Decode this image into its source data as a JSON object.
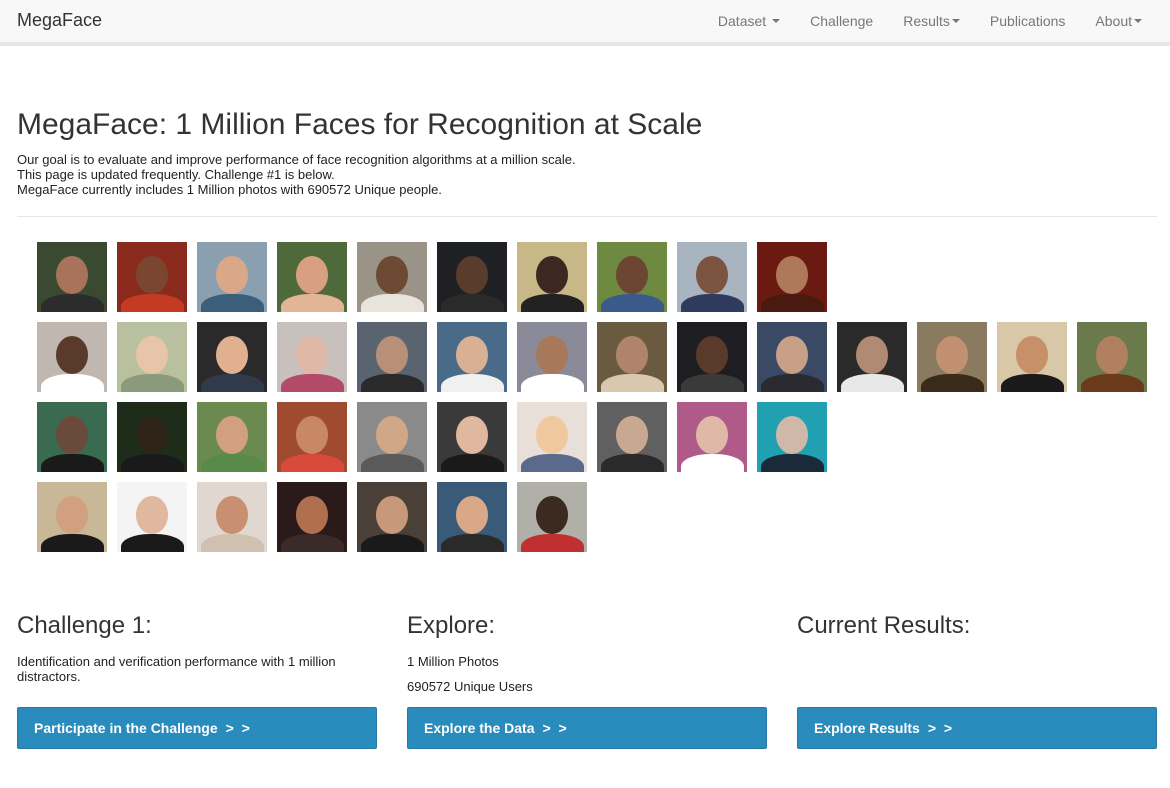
{
  "navbar": {
    "brand": "MegaFace",
    "items": [
      {
        "label": "Dataset",
        "caret": true
      },
      {
        "label": "Challenge",
        "caret": false
      },
      {
        "label": "Results",
        "caret": true
      },
      {
        "label": "Publications",
        "caret": false
      },
      {
        "label": "About",
        "caret": true
      }
    ]
  },
  "header": {
    "title": "MegaFace: 1 Million Faces for Recognition at Scale",
    "lines": [
      "Our goal is to evaluate and improve performance of face recognition algorithms at a million scale.",
      "This page is updated frequently. Challenge #1 is below.",
      "MegaFace currently includes 1 Million photos with 690572 Unique people."
    ]
  },
  "faces": {
    "rows": [
      [
        {
          "bg": "#3a4a30",
          "skin": "#a8735a",
          "shirt": "#2c2c2c"
        },
        {
          "bg": "#8a2a1c",
          "skin": "#7a4630",
          "shirt": "#c43a22"
        },
        {
          "bg": "#8aa0b0",
          "skin": "#d9a888",
          "shirt": "#3b5e7a"
        },
        {
          "bg": "#4e6a3a",
          "skin": "#d8a080",
          "shirt": "#e2b597"
        },
        {
          "bg": "#9a9488",
          "skin": "#6d4a34",
          "shirt": "#e8e4dc"
        },
        {
          "bg": "#1e2024",
          "skin": "#5a3c2c",
          "shirt": "#2a2a2a"
        },
        {
          "bg": "#c8b888",
          "skin": "#3c2820",
          "shirt": "#222222"
        },
        {
          "bg": "#6e8a40",
          "skin": "#6c4632",
          "shirt": "#3a5a8a"
        },
        {
          "bg": "#a8b4c0",
          "skin": "#7a5440",
          "shirt": "#2e3a5e"
        },
        {
          "bg": "#6a1a10",
          "skin": "#b0785a",
          "shirt": "#4a1a10"
        }
      ],
      [
        {
          "bg": "#c0b8b0",
          "skin": "#5a3a2a",
          "shirt": "#ffffff"
        },
        {
          "bg": "#b8c0a0",
          "skin": "#e8c4a8",
          "shirt": "#8a9a7a"
        },
        {
          "bg": "#2a2a2a",
          "skin": "#e0b090",
          "shirt": "#303a4a"
        },
        {
          "bg": "#c8c0bc",
          "skin": "#e0b8a8",
          "shirt": "#b44a6a"
        },
        {
          "bg": "#5a6470",
          "skin": "#b89078",
          "shirt": "#2a2a2a"
        },
        {
          "bg": "#4a6a8a",
          "skin": "#d8b094",
          "shirt": "#f0f0f0"
        },
        {
          "bg": "#8a8a98",
          "skin": "#a8785a",
          "shirt": "#ffffff"
        },
        {
          "bg": "#6a5a40",
          "skin": "#b0846a",
          "shirt": "#d8c8b0"
        },
        {
          "bg": "#1e1e22",
          "skin": "#5a3a2a",
          "shirt": "#3a3a3a"
        },
        {
          "bg": "#3a4a64",
          "skin": "#c8a088",
          "shirt": "#2a2a30"
        },
        {
          "bg": "#2a2a2a",
          "skin": "#b08a72",
          "shirt": "#e8e8e8"
        },
        {
          "bg": "#8a7a60",
          "skin": "#c09070",
          "shirt": "#3a2a1a"
        },
        {
          "bg": "#d8c8a8",
          "skin": "#c89068",
          "shirt": "#1a1a1a"
        },
        {
          "bg": "#6a7a4a",
          "skin": "#b08060",
          "shirt": "#6a3a1a"
        }
      ],
      [
        {
          "bg": "#3a6a50",
          "skin": "#6a4a3a",
          "shirt": "#1a1a1a"
        },
        {
          "bg": "#1e2c1a",
          "skin": "#2e2418",
          "shirt": "#1a1a1a"
        },
        {
          "bg": "#6a8a50",
          "skin": "#d0a080",
          "shirt": "#5a8a4a"
        },
        {
          "bg": "#a04a30",
          "skin": "#c88868",
          "shirt": "#d84a3a"
        },
        {
          "bg": "#8a8a8a",
          "skin": "#d0a888",
          "shirt": "#5a5a5a"
        },
        {
          "bg": "#3a3a3a",
          "skin": "#e0b8a0",
          "shirt": "#1a1a1a"
        },
        {
          "bg": "#e8e0d8",
          "skin": "#f0c8a0",
          "shirt": "#5a6a8a"
        },
        {
          "bg": "#606060",
          "skin": "#c8a890",
          "shirt": "#2a2a2a"
        },
        {
          "bg": "#b05a8a",
          "skin": "#e0b8a8",
          "shirt": "#ffffff"
        },
        {
          "bg": "#20a0b0",
          "skin": "#d0b8a8",
          "shirt": "#1a2a3a"
        }
      ],
      [
        {
          "bg": "#c8b898",
          "skin": "#d0a080",
          "shirt": "#1a1a1a"
        },
        {
          "bg": "#f4f4f4",
          "skin": "#e0b8a0",
          "shirt": "#1a1a1a"
        },
        {
          "bg": "#e0d8d0",
          "skin": "#c89070",
          "shirt": "#d0c0b0"
        },
        {
          "bg": "#2a1a1a",
          "skin": "#b07050",
          "shirt": "#3a2a2a"
        },
        {
          "bg": "#4a4038",
          "skin": "#c8987a",
          "shirt": "#1a1a1a"
        },
        {
          "bg": "#3a5a7a",
          "skin": "#d8a888",
          "shirt": "#2a2a2a"
        },
        {
          "bg": "#b0b0a8",
          "skin": "#3a2a20",
          "shirt": "#c03030"
        }
      ]
    ]
  },
  "columns": [
    {
      "heading": "Challenge 1:",
      "lines": [
        "Identification and verification performance with 1 million distractors."
      ],
      "button": "Participate in the Challenge"
    },
    {
      "heading": "Explore:",
      "lines": [
        "1 Million Photos",
        "690572 Unique Users"
      ],
      "button": "Explore the Data"
    },
    {
      "heading": "Current Results:",
      "lines": [],
      "button": "Explore Results"
    }
  ],
  "button_chevrons": "> >"
}
